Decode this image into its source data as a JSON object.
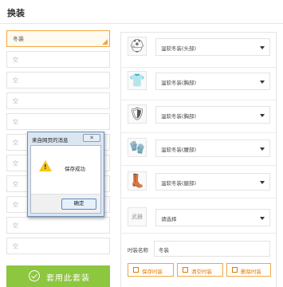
{
  "header": {
    "title": "换装"
  },
  "slots": [
    {
      "label": "冬装",
      "active": true
    },
    {
      "label": "空"
    },
    {
      "label": "空"
    },
    {
      "label": "空"
    },
    {
      "label": "空"
    },
    {
      "label": "空"
    },
    {
      "label": "空"
    },
    {
      "label": "空"
    },
    {
      "label": "空"
    },
    {
      "label": "空"
    },
    {
      "label": "空"
    }
  ],
  "apply_button": {
    "label": "套用此套装"
  },
  "equipment": [
    {
      "icon": "helmet-icon",
      "glyph": "⛑",
      "value": "温软冬装(头部)"
    },
    {
      "icon": "body-armor-icon",
      "glyph": "👕",
      "value": "温软冬装(胸部)"
    },
    {
      "icon": "chest-armor-icon",
      "glyph": "🛡",
      "value": "温软冬装(胸部)"
    },
    {
      "icon": "gloves-icon",
      "glyph": "🧤",
      "value": "温软冬装(腰部)"
    },
    {
      "icon": "boots-icon",
      "glyph": "👢",
      "value": "温软冬装(腿部)"
    },
    {
      "icon": "weapon-icon",
      "glyph": "武器",
      "value": "请选择"
    }
  ],
  "outfit_name": {
    "label": "时装名称",
    "value": "冬装"
  },
  "actions": {
    "save": "保存时装",
    "clear": "清空时装",
    "delete": "删除时装"
  },
  "dialog": {
    "title": "来自网页的消息",
    "close": "✕",
    "message": "保存成功",
    "ok": "确定"
  },
  "colors": {
    "accent": "#f0a640",
    "apply_green": "#8dc63f"
  }
}
